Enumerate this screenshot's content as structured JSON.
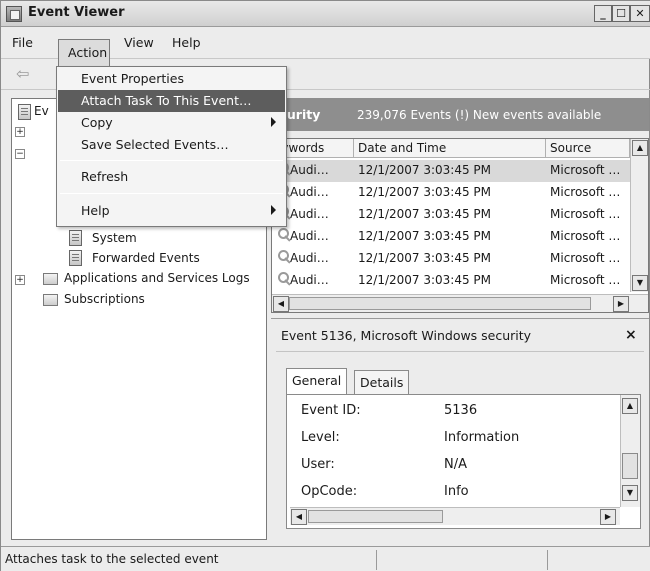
{
  "window": {
    "title": "Event Viewer",
    "min_glyph": "_",
    "max_glyph": "☐",
    "close_glyph": "✕"
  },
  "menubar": {
    "items": [
      "File",
      "Action",
      "View",
      "Help"
    ]
  },
  "action_menu": {
    "items": [
      {
        "label": "Event Properties",
        "submenu": false
      },
      {
        "label": "Attach Task To This Event…",
        "submenu": false,
        "highlighted": true
      },
      {
        "label": "Copy",
        "submenu": true
      },
      {
        "label": "Save Selected Events…",
        "submenu": false
      },
      {
        "label": "Refresh",
        "submenu": false
      },
      {
        "label": "Help",
        "submenu": true
      }
    ]
  },
  "tree": {
    "root_label_partial": "Ev",
    "items": [
      {
        "label": "System",
        "icon": "log-icon"
      },
      {
        "label": "Forwarded Events",
        "icon": "log-icon"
      },
      {
        "label": "Applications and Services Logs",
        "icon": "folder-icon",
        "expander": "+"
      },
      {
        "label": "Subscriptions",
        "icon": "folder-icon"
      }
    ]
  },
  "list_header": {
    "name_partial": "ecurity",
    "info": "239,076 Events (!) New events available"
  },
  "grid": {
    "columns": [
      "Keywords",
      "Date and Time",
      "Source"
    ],
    "column_labels_visible": [
      "eywords",
      "Date and Time",
      "Source"
    ],
    "rows": [
      {
        "keywords": "Audi…",
        "datetime": "12/1/2007 3:03:45 PM",
        "source": "Microsoft …",
        "selected": true
      },
      {
        "keywords": "Audi…",
        "datetime": "12/1/2007 3:03:45 PM",
        "source": "Microsoft …"
      },
      {
        "keywords": "Audi…",
        "datetime": "12/1/2007 3:03:45 PM",
        "source": "Microsoft …"
      },
      {
        "keywords": "Audi…",
        "datetime": "12/1/2007 3:03:45 PM",
        "source": "Microsoft …"
      },
      {
        "keywords": "Audi…",
        "datetime": "12/1/2007 3:03:45 PM",
        "source": "Microsoft …"
      },
      {
        "keywords": "Audi…",
        "datetime": "12/1/2007 3:03:45 PM",
        "source": "Microsoft …"
      }
    ]
  },
  "detail": {
    "title": "Event 5136, Microsoft Windows security",
    "close_glyph": "×",
    "tabs": [
      "General",
      "Details"
    ],
    "active_tab": "General",
    "props": [
      {
        "label": "Event ID:",
        "value": "5136"
      },
      {
        "label": "Level:",
        "value": "Information"
      },
      {
        "label": "User:",
        "value": "N/A"
      },
      {
        "label": "OpCode:",
        "value": "Info"
      }
    ]
  },
  "statusbar": {
    "text": "Attaches task to the selected event"
  },
  "colors": {
    "highlight": "#5d5d5d",
    "header": "#8e8e8e",
    "selected_row": "#d9d9d9"
  }
}
